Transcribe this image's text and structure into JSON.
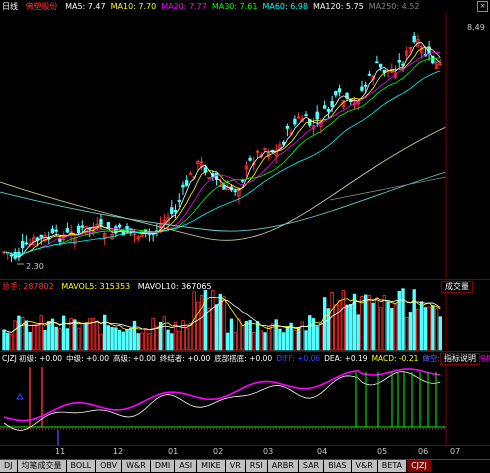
{
  "price_header": {
    "period": "日线",
    "stock_name": "佛塑股份",
    "ma": [
      {
        "label": "MA5: 7.47",
        "color": "#ffffff"
      },
      {
        "label": "MA10: 7.70",
        "color": "#ffff00"
      },
      {
        "label": "MA20: 7.77",
        "color": "#ff00ff"
      },
      {
        "label": "MA30: 7.61",
        "color": "#00ff00"
      },
      {
        "label": "MA60: 6.98",
        "color": "#00ffff"
      },
      {
        "label": "MA120: 5.75",
        "color": "#ffffff"
      },
      {
        "label": "MA250: 4.52",
        "color": "#808080"
      }
    ]
  },
  "price_marks": {
    "high": "8.49",
    "low": "2.30"
  },
  "volume_header": {
    "total": "总手: 287802",
    "mavol5": "MAVOL5: 315353",
    "mavol10": "MAVOL10: 367065",
    "button": "成交量"
  },
  "indicator_header": {
    "items": [
      {
        "label": "CJZJ 初级: +0.00",
        "color": "#ffffff"
      },
      {
        "label": "中级: +0.00",
        "color": "#ffffff"
      },
      {
        "label": "高级: +0.00",
        "color": "#ffffff"
      },
      {
        "label": "终结者: +0.00",
        "color": "#ffffff"
      },
      {
        "label": "底部搭底: +0.00",
        "color": "#ffffff"
      },
      {
        "label": "DIFF: +0.06",
        "color": "#4040ff"
      },
      {
        "label": "DEA: +0.19",
        "color": "#ffffff"
      },
      {
        "label": "MACD: -0.21",
        "color": "#ffff00"
      },
      {
        "label": "做空: 0.00",
        "color": "#6060ff"
      },
      {
        "label": "短线拐机",
        "color": "#ff00ff"
      }
    ],
    "button": "指标说明"
  },
  "x_axis_labels": [
    "11",
    "12",
    "01",
    "02",
    "03",
    "04",
    "05",
    "06",
    "07"
  ],
  "tabs": [
    "DJ",
    "均笔成交量",
    "BOLL",
    "OBV",
    "W&R",
    "DMI",
    "ASI",
    "MIKE",
    "VR",
    "RSI",
    "ARBR",
    "SAR",
    "BIAS",
    "V&R",
    "BETA",
    "CJZJ"
  ],
  "active_tab": "CJZJ",
  "colors": {
    "up": "#ff3232",
    "down": "#54ffff",
    "frame": "#800000",
    "bg": "#000000"
  }
}
